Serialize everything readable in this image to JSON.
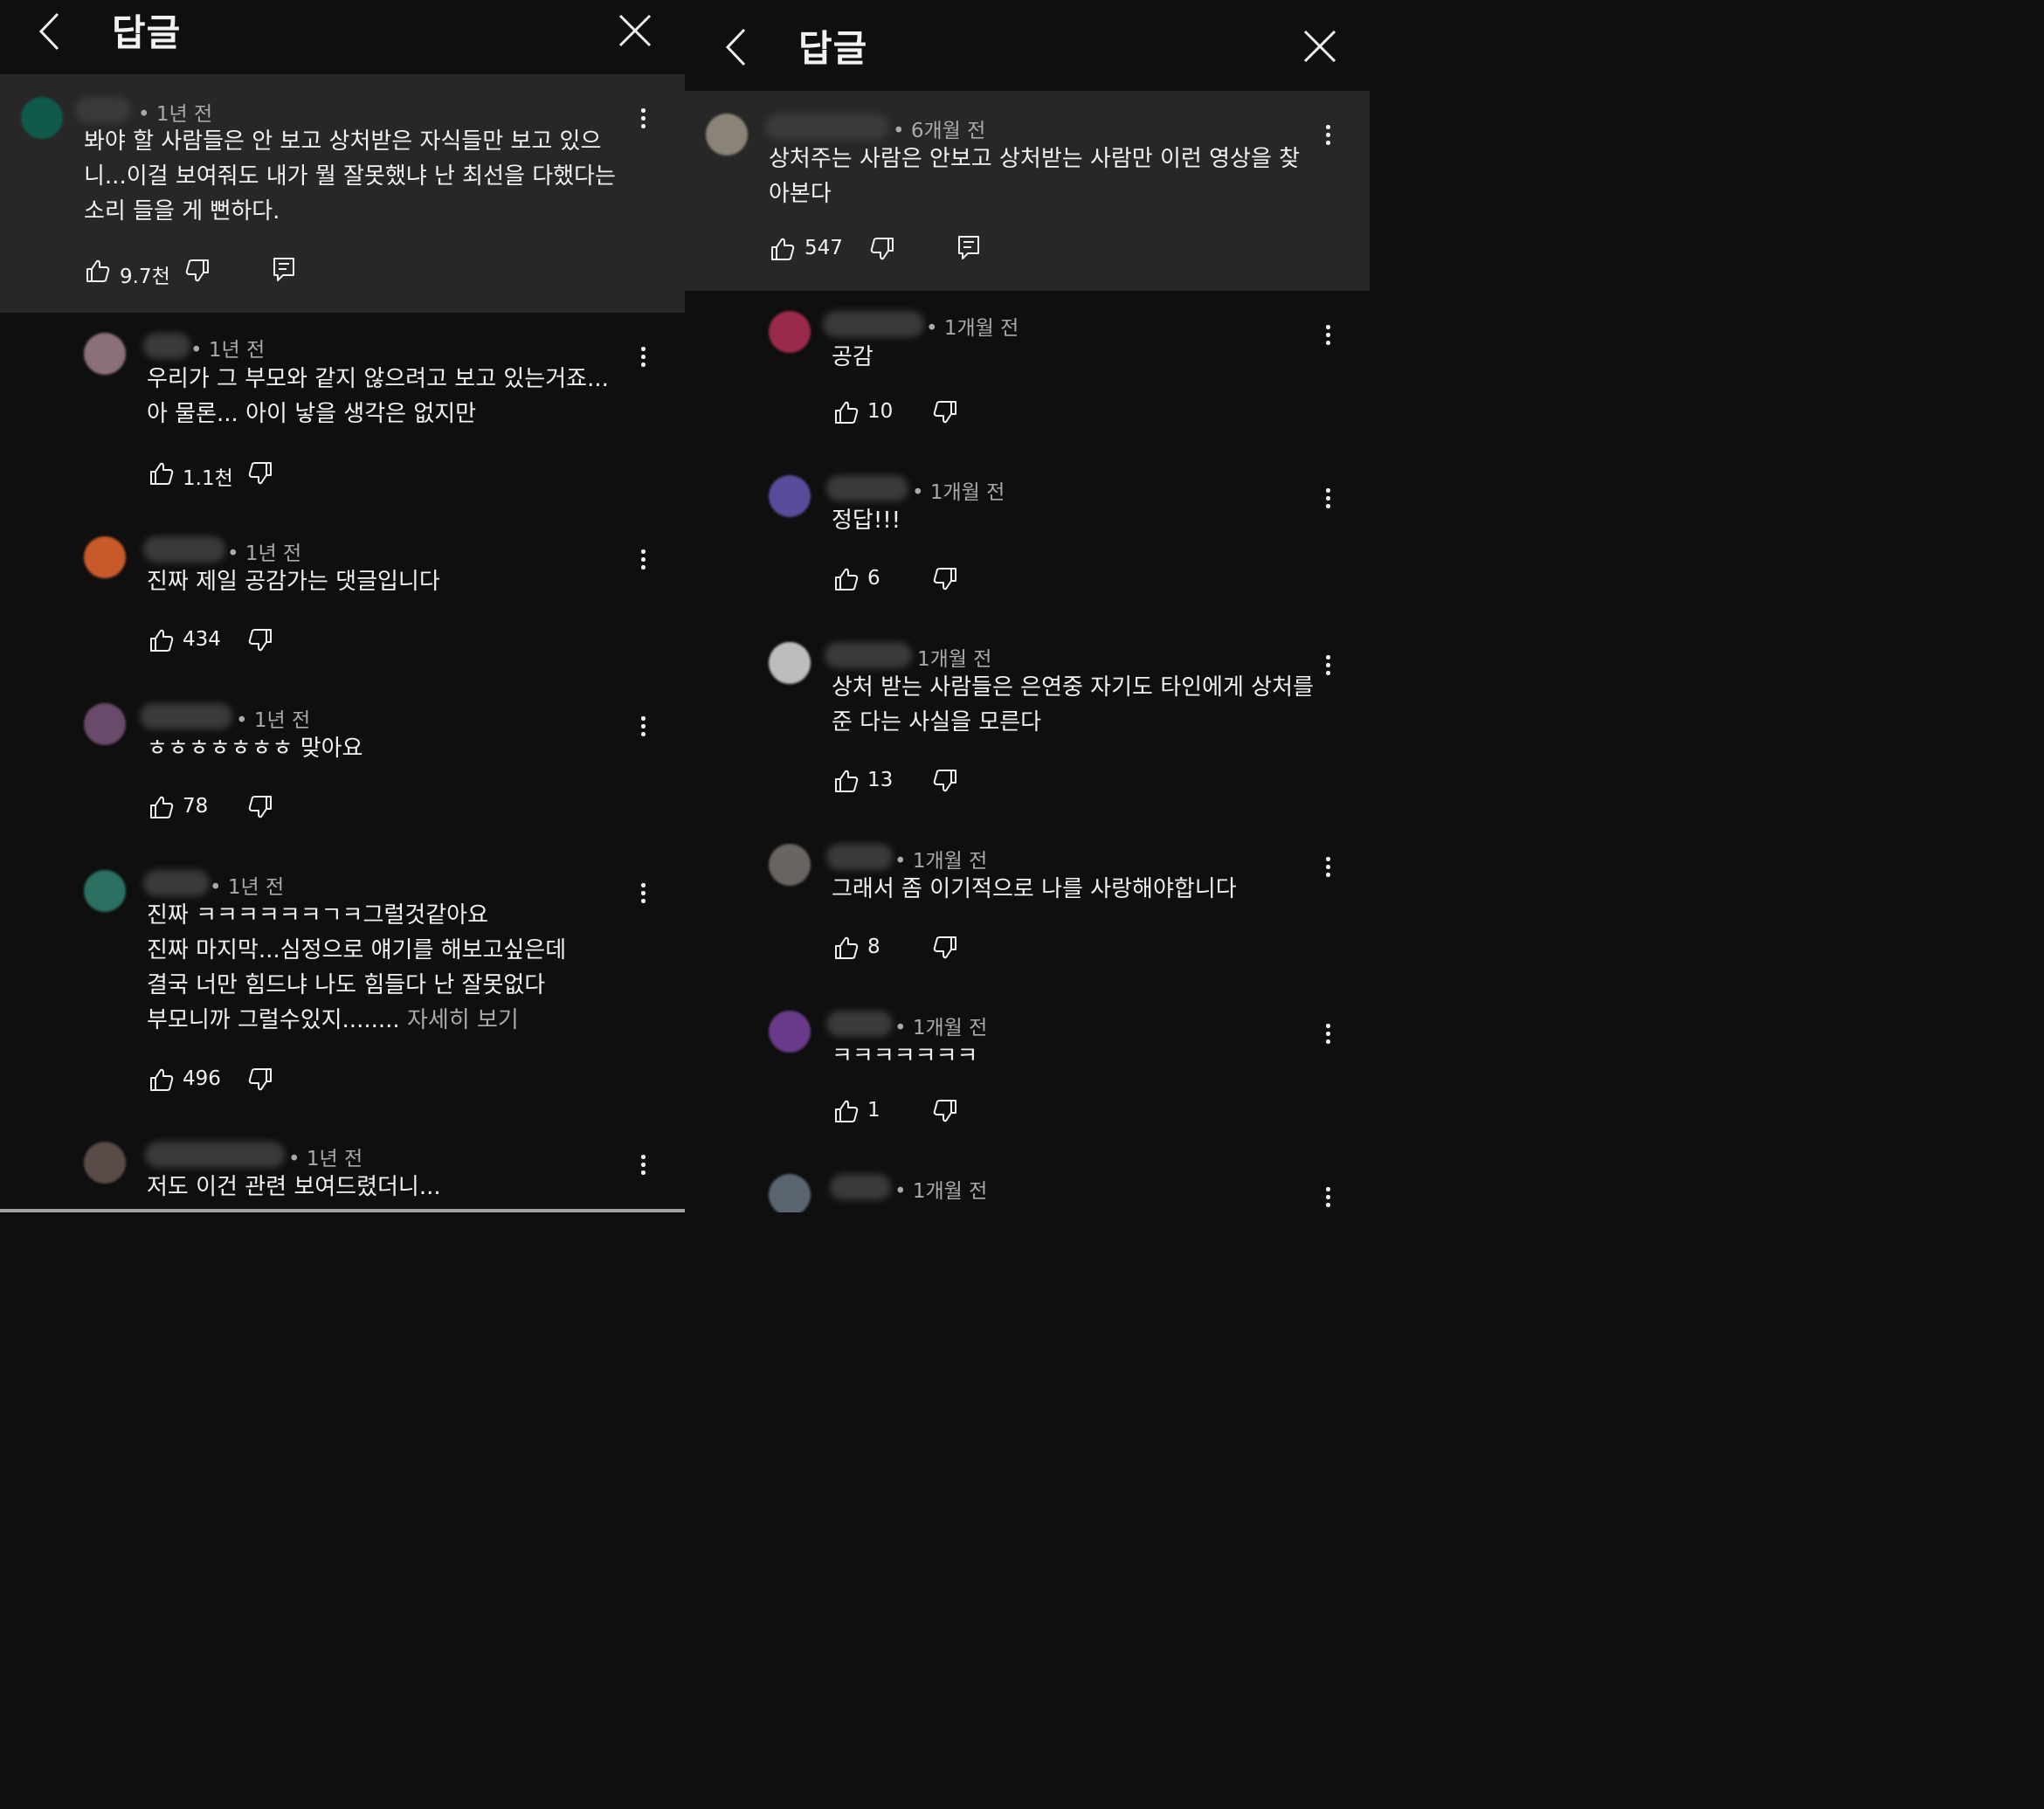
{
  "left": {
    "title": "답글",
    "parent": {
      "time": "• 1년 전",
      "lines": [
        "봐야 할 사람들은 안 보고 상처받은 자식들만 보고 있으",
        "니...이걸 보여줘도 내가 뭘 잘못했냐 난 최선을 다했다는",
        "소리 들을 게 뻔하다."
      ],
      "likes": "9.7천",
      "avatar_color": "#0f5a4a"
    },
    "replies": [
      {
        "time": "• 1년 전",
        "lines": [
          "우리가 그 부모와 같지 않으려고 보고 있는거죠...",
          "아 물론... 아이 낳을 생각은 없지만"
        ],
        "likes": "1.1천",
        "avatar_color": "#8a7078"
      },
      {
        "time": "• 1년 전",
        "lines": [
          "진짜 제일 공감가는 댓글입니다"
        ],
        "likes": "434",
        "avatar_color": "#c85a2a"
      },
      {
        "time": "• 1년 전",
        "lines": [
          "ㅎㅎㅎㅎㅎㅎㅎ 맞아요"
        ],
        "likes": "78",
        "avatar_color": "#6a4a6a"
      },
      {
        "time": "• 1년 전",
        "lines": [
          "진짜 ㅋㅋㅋㅋㅋㅋㄱㅋ그럴것같아요",
          "진짜 마지막...심정으로 얘기를 해보고싶은데",
          "결국 너만 힘드냐 나도 힘들다 난 잘못없다"
        ],
        "last_line": "부모니까 그럴수있지........",
        "more": "자세히 보기",
        "likes": "496",
        "avatar_color": "#2a7060"
      },
      {
        "time": "• 1년 전",
        "lines": [
          "저도 이건 관련 보여드렸더니..."
        ],
        "avatar_color": "#5a4a48"
      }
    ]
  },
  "right": {
    "title": "답글",
    "parent": {
      "time": "• 6개월 전",
      "lines": [
        "상처주는 사람은 안보고 상처받는 사람만 이런 영상을 찾",
        "아본다"
      ],
      "likes": "547",
      "avatar_color": "#8a8478"
    },
    "replies": [
      {
        "time": "• 1개월 전",
        "lines": [
          "공감"
        ],
        "likes": "10",
        "avatar_color": "#9a2a4a"
      },
      {
        "time": "• 1개월 전",
        "lines": [
          "정답!!!"
        ],
        "likes": "6",
        "avatar_color": "#5a4a9a"
      },
      {
        "time": "1개월 전",
        "lines": [
          "상처 받는 사람들은 은연중 자기도 타인에게 상처를",
          "준 다는 사실을 모른다"
        ],
        "likes": "13",
        "avatar_color": "#bdbdbd"
      },
      {
        "time": "• 1개월 전",
        "lines": [
          "그래서 좀 이기적으로 나를 사랑해야합니다"
        ],
        "likes": "8",
        "avatar_color": "#6a6460"
      },
      {
        "time": "• 1개월 전",
        "lines": [
          "ㅋㅋㅋㅋㅋㅋㅋ"
        ],
        "likes": "1",
        "avatar_color": "#6a3a8a"
      },
      {
        "time": "• 1개월 전",
        "lines": [],
        "avatar_color": "#5a6470"
      }
    ]
  }
}
